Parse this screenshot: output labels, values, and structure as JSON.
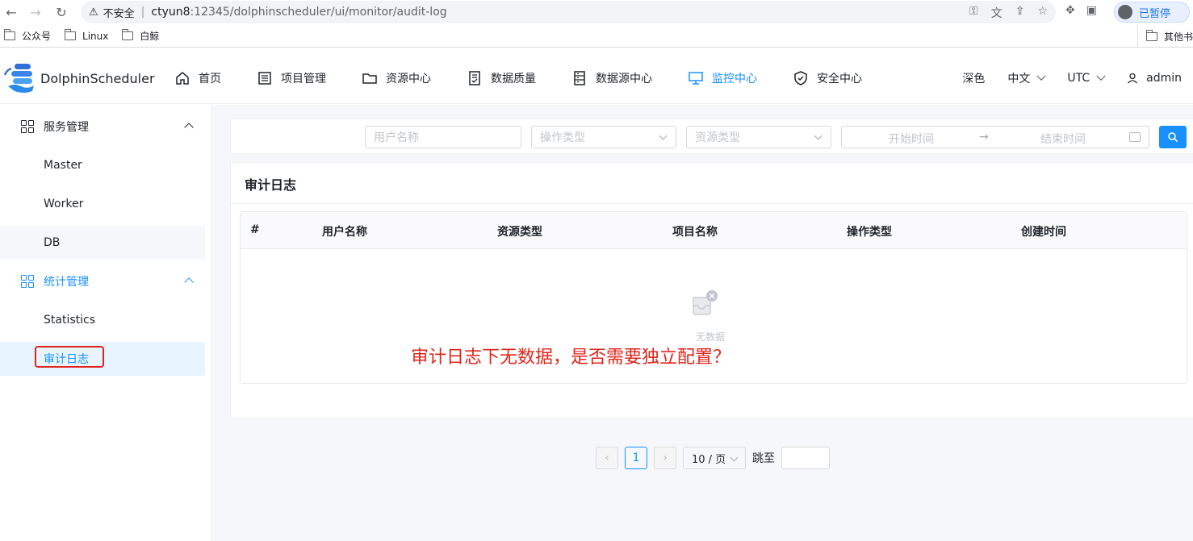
{
  "browser": {
    "security_text": "不安全",
    "url_host": "ctyun8",
    "url_path": ":12345/dolphinscheduler/ui/monitor/audit-log",
    "profile_status": "已暂停",
    "bookmarks": [
      "公众号",
      "Linux",
      "白鲸"
    ],
    "other_bookmarks": "其他书"
  },
  "app": {
    "logo_text": "DolphinScheduler",
    "nav": [
      {
        "label": "首页",
        "icon": "home-icon"
      },
      {
        "label": "项目管理",
        "icon": "project-icon"
      },
      {
        "label": "资源中心",
        "icon": "folder-icon"
      },
      {
        "label": "数据质量",
        "icon": "document-check-icon"
      },
      {
        "label": "数据源中心",
        "icon": "database-icon"
      },
      {
        "label": "监控中心",
        "icon": "monitor-icon",
        "active": true
      },
      {
        "label": "安全中心",
        "icon": "shield-icon"
      }
    ],
    "theme_label": "深色",
    "language": "中文",
    "timezone": "UTC",
    "user": "admin"
  },
  "sidebar": {
    "groups": [
      {
        "label": "服务管理",
        "items": [
          "Master",
          "Worker",
          "DB"
        ]
      },
      {
        "label": "统计管理",
        "items": [
          "Statistics",
          "审计日志"
        ]
      }
    ]
  },
  "filters": {
    "user_placeholder": "用户名称",
    "operation_placeholder": "操作类型",
    "resource_placeholder": "资源类型",
    "start_placeholder": "开始时间",
    "end_placeholder": "结束时间"
  },
  "card": {
    "title": "审计日志",
    "columns": [
      "#",
      "用户名称",
      "资源类型",
      "项目名称",
      "操作类型",
      "创建时间"
    ],
    "rows": [],
    "empty_text": "无数据",
    "annotation": "审计日志下无数据，是否需要独立配置？"
  },
  "pagination": {
    "current_page": "1",
    "page_size": "10 / 页",
    "jump_label": "跳至"
  },
  "colors": {
    "primary": "#1890ff",
    "annotation_red": "#e0241a"
  }
}
